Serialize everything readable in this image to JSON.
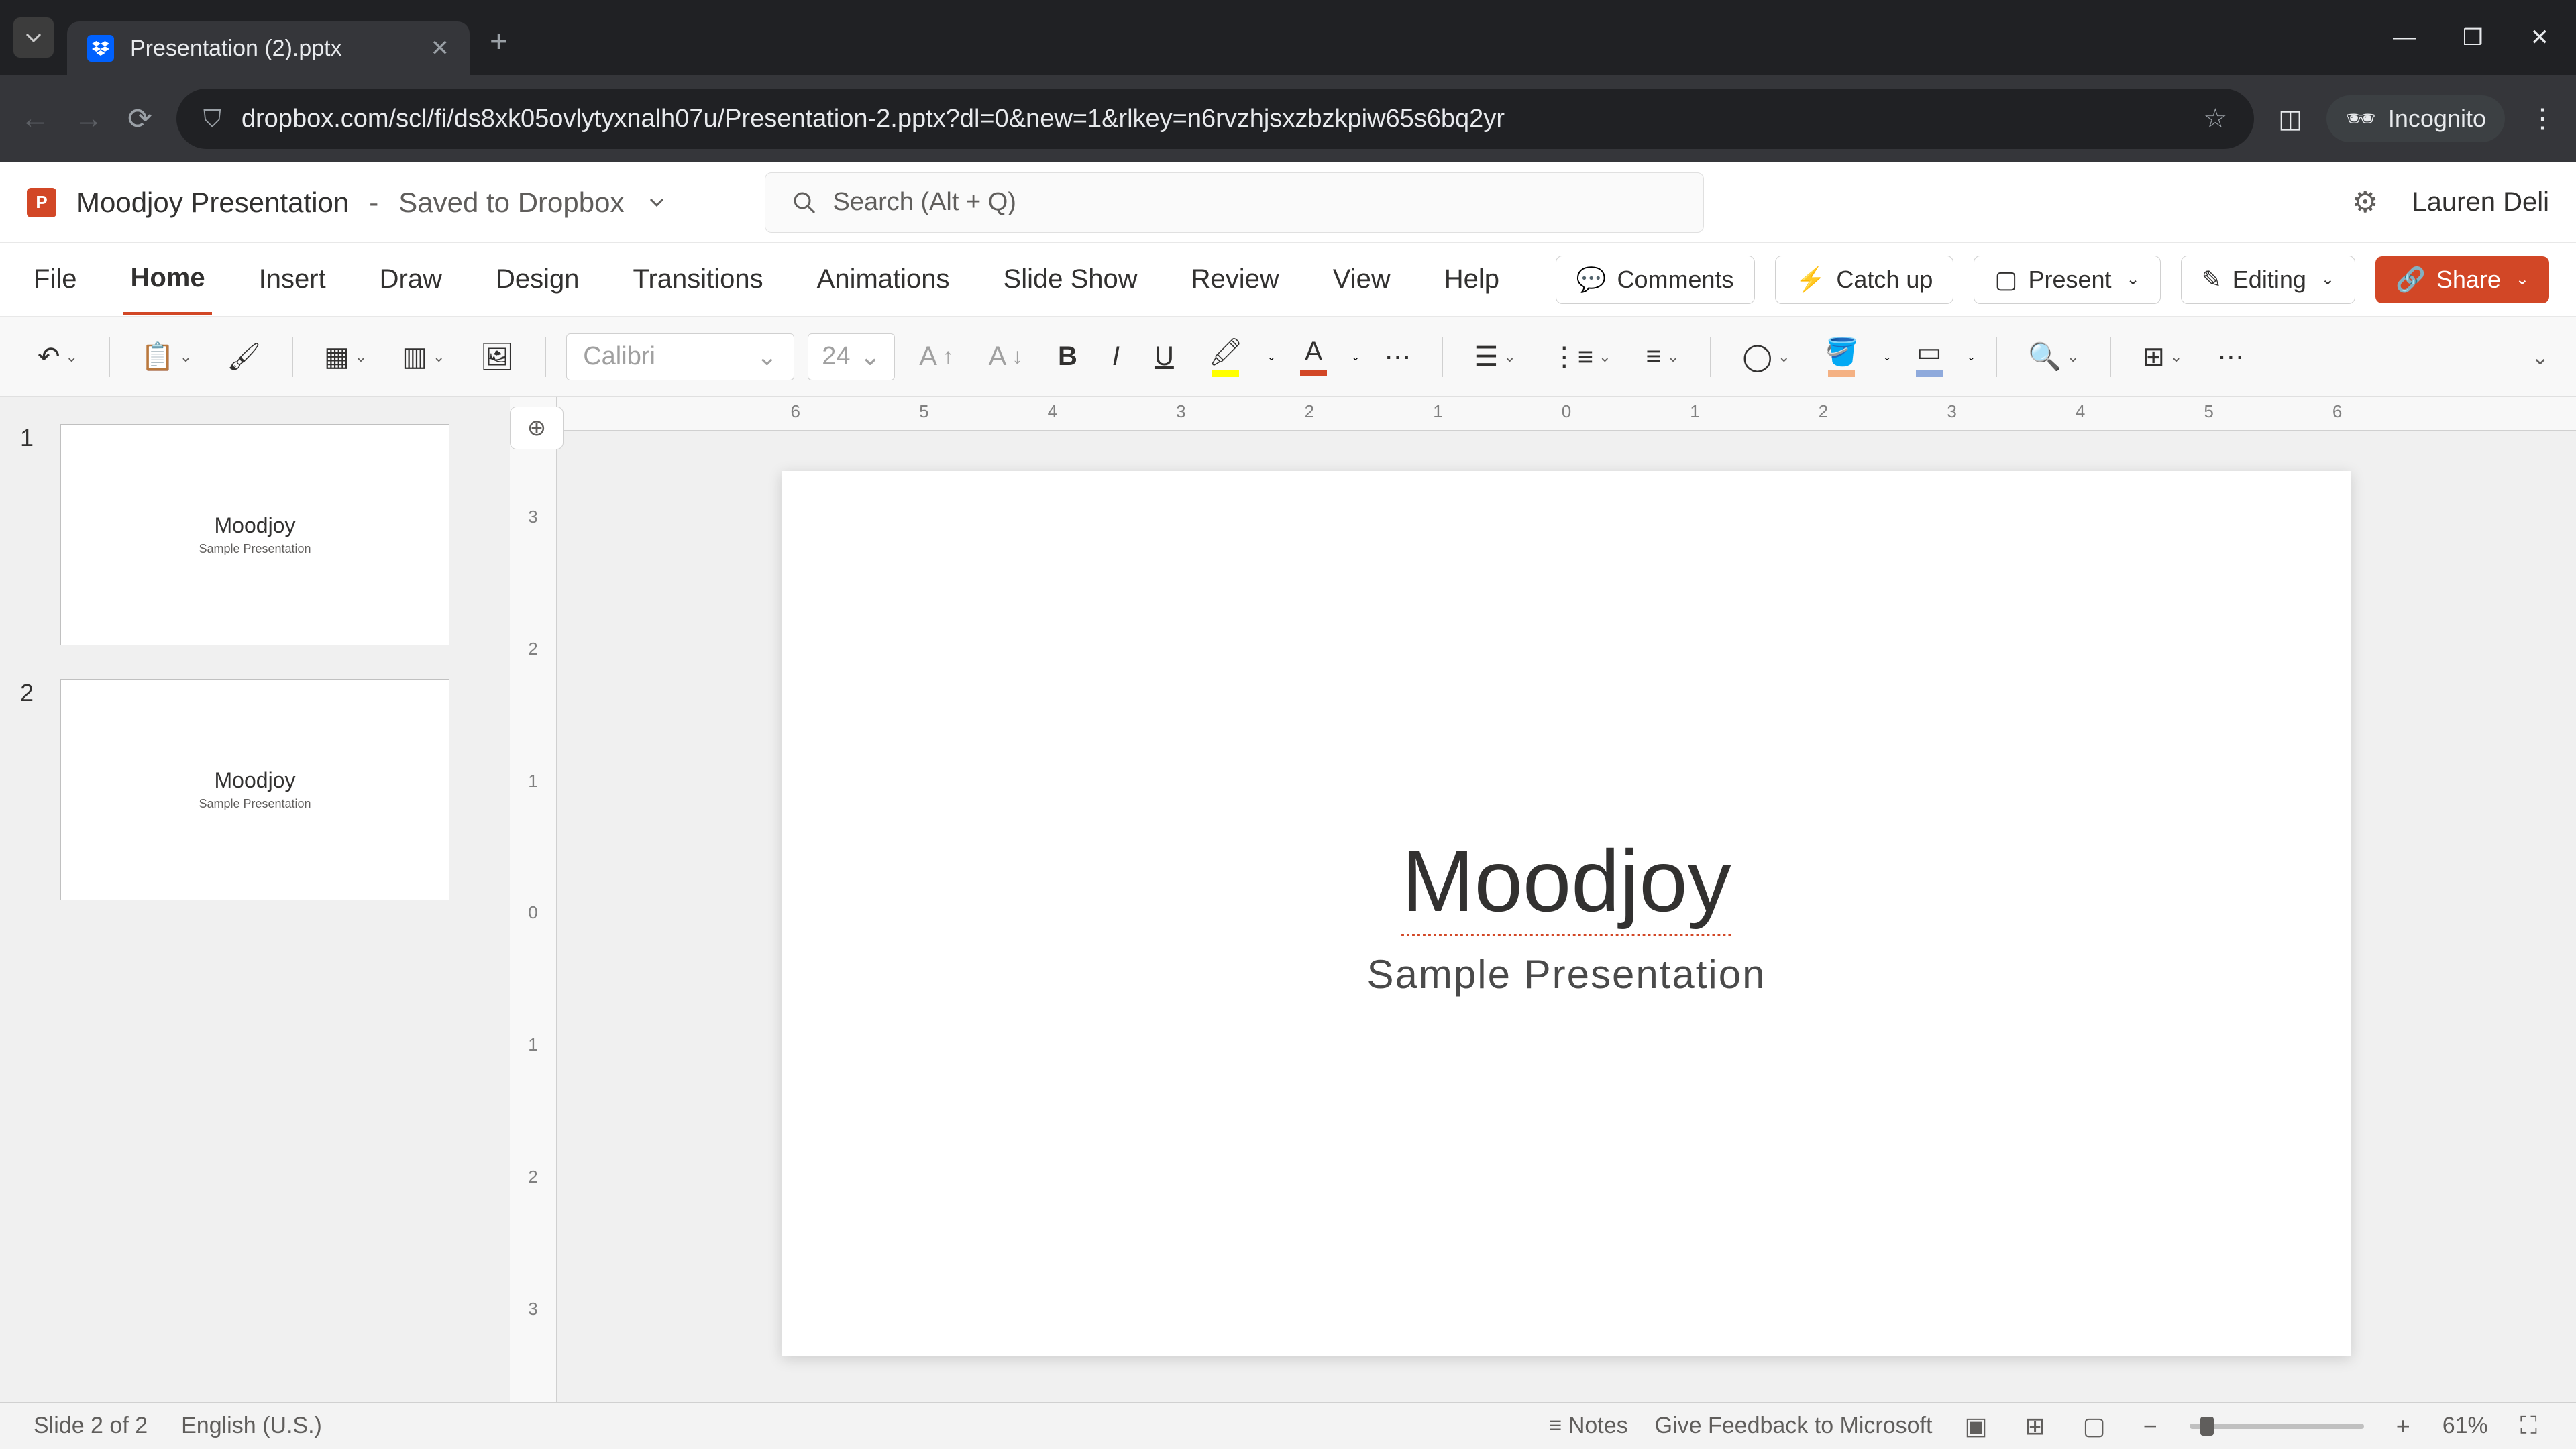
{
  "browser": {
    "tab_title": "Presentation (2).pptx",
    "url": "dropbox.com/scl/fi/ds8xk05ovlytyxnalh07u/Presentation-2.pptx?dl=0&new=1&rlkey=n6rvzhjsxzbzkpiw65s6bq2yr",
    "incognito_label": "Incognito"
  },
  "title_bar": {
    "doc_name": "Moodjoy Presentation",
    "saved_status": "Saved to Dropbox",
    "search_placeholder": "Search (Alt + Q)",
    "user_name": "Lauren Deli"
  },
  "ribbon": {
    "tabs": [
      "File",
      "Home",
      "Insert",
      "Draw",
      "Design",
      "Transitions",
      "Animations",
      "Slide Show",
      "Review",
      "View",
      "Help"
    ],
    "active_tab": "Home",
    "comments": "Comments",
    "catch_up": "Catch up",
    "present": "Present",
    "editing": "Editing",
    "share": "Share"
  },
  "toolbar": {
    "font_name": "Calibri",
    "font_size": "24"
  },
  "ruler_h": [
    "6",
    "5",
    "4",
    "3",
    "2",
    "1",
    "0",
    "1",
    "2",
    "3",
    "4",
    "5",
    "6"
  ],
  "ruler_v": [
    "3",
    "2",
    "1",
    "0",
    "1",
    "2",
    "3"
  ],
  "thumbnails": [
    {
      "num": "1",
      "title": "Moodjoy",
      "subtitle": "Sample Presentation",
      "selected": false
    },
    {
      "num": "2",
      "title": "Moodjoy",
      "subtitle": "Sample Presentation",
      "selected": false
    }
  ],
  "slide": {
    "title": "Moodjoy",
    "subtitle": "Sample Presentation"
  },
  "status": {
    "slide_count": "Slide 2 of 2",
    "language": "English (U.S.)",
    "notes": "Notes",
    "feedback": "Give Feedback to Microsoft",
    "zoom": "61%"
  }
}
